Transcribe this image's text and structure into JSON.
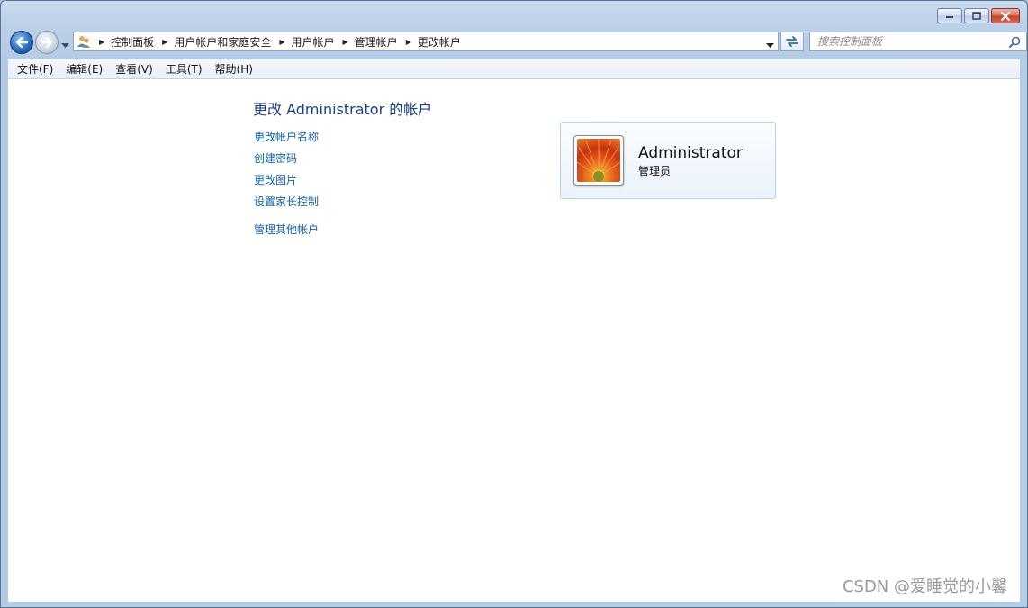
{
  "window": {
    "caption": {
      "minimize_icon": "minimize-icon",
      "maximize_icon": "maximize-icon",
      "close_icon": "close-icon"
    }
  },
  "navigation": {
    "breadcrumbs": [
      "控制面板",
      "用户帐户和家庭安全",
      "用户帐户",
      "管理帐户",
      "更改帐户"
    ],
    "search_placeholder": "搜索控制面板"
  },
  "menu": [
    "文件(F)",
    "编辑(E)",
    "查看(V)",
    "工具(T)",
    "帮助(H)"
  ],
  "main": {
    "title": "更改 Administrator 的帐户",
    "links": [
      "更改帐户名称",
      "创建密码",
      "更改图片",
      "设置家长控制"
    ],
    "other_link": "管理其他帐户",
    "account": {
      "name": "Administrator",
      "role": "管理员"
    }
  },
  "watermark": "CSDN @爱睡觉的小馨",
  "colors": {
    "link": "#1563b1",
    "title": "#1e3f8f",
    "close_button": "#c6402a"
  }
}
